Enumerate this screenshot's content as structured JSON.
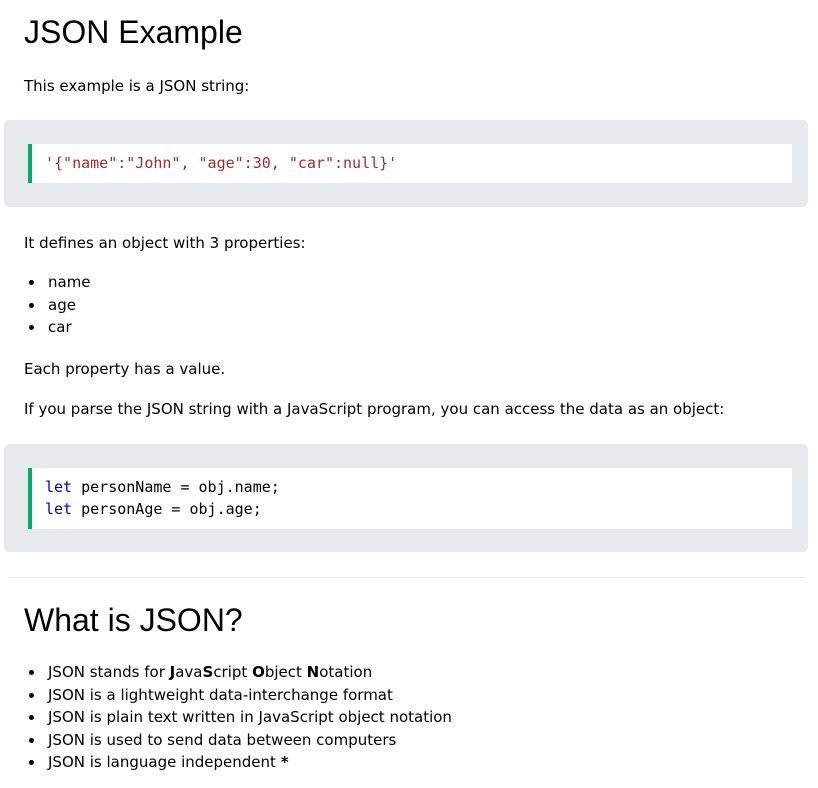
{
  "page_title": "JSON Example",
  "intro": "This example is a JSON string:",
  "json_example": "'{\"name\":\"John\", \"age\":30, \"car\":null}'",
  "defines_text": "It defines an object with 3 properties:",
  "properties": [
    "name",
    "age",
    "car"
  ],
  "each_text": "Each property has a value.",
  "parse_text": "If you parse the JSON string with a JavaScript program, you can access the data as an object:",
  "code": {
    "line1_kw": "let",
    "line1_rest": " personName = obj.name;",
    "line2_kw": "let",
    "line2_rest": " personAge = obj.age;"
  },
  "section2_title": "What is JSON?",
  "facts": {
    "f1_prefix": "JSON stands for ",
    "f1_b1": "J",
    "f1_t1": "ava",
    "f1_b2": "S",
    "f1_t2": "cript ",
    "f1_b3": "O",
    "f1_t3": "bject ",
    "f1_b4": "N",
    "f1_t4": "otation",
    "f2": "JSON is a lightweight data-interchange format",
    "f3": "JSON is plain text written in JavaScript object notation",
    "f4": "JSON is used to send data between computers",
    "f5_text": "JSON is language independent ",
    "f5_star": "*"
  },
  "colors": {
    "accent_border": "#04aa6d",
    "example_bg": "#e7e9eb",
    "json_string": "#a52a2a",
    "keyword": "#0000cd"
  }
}
